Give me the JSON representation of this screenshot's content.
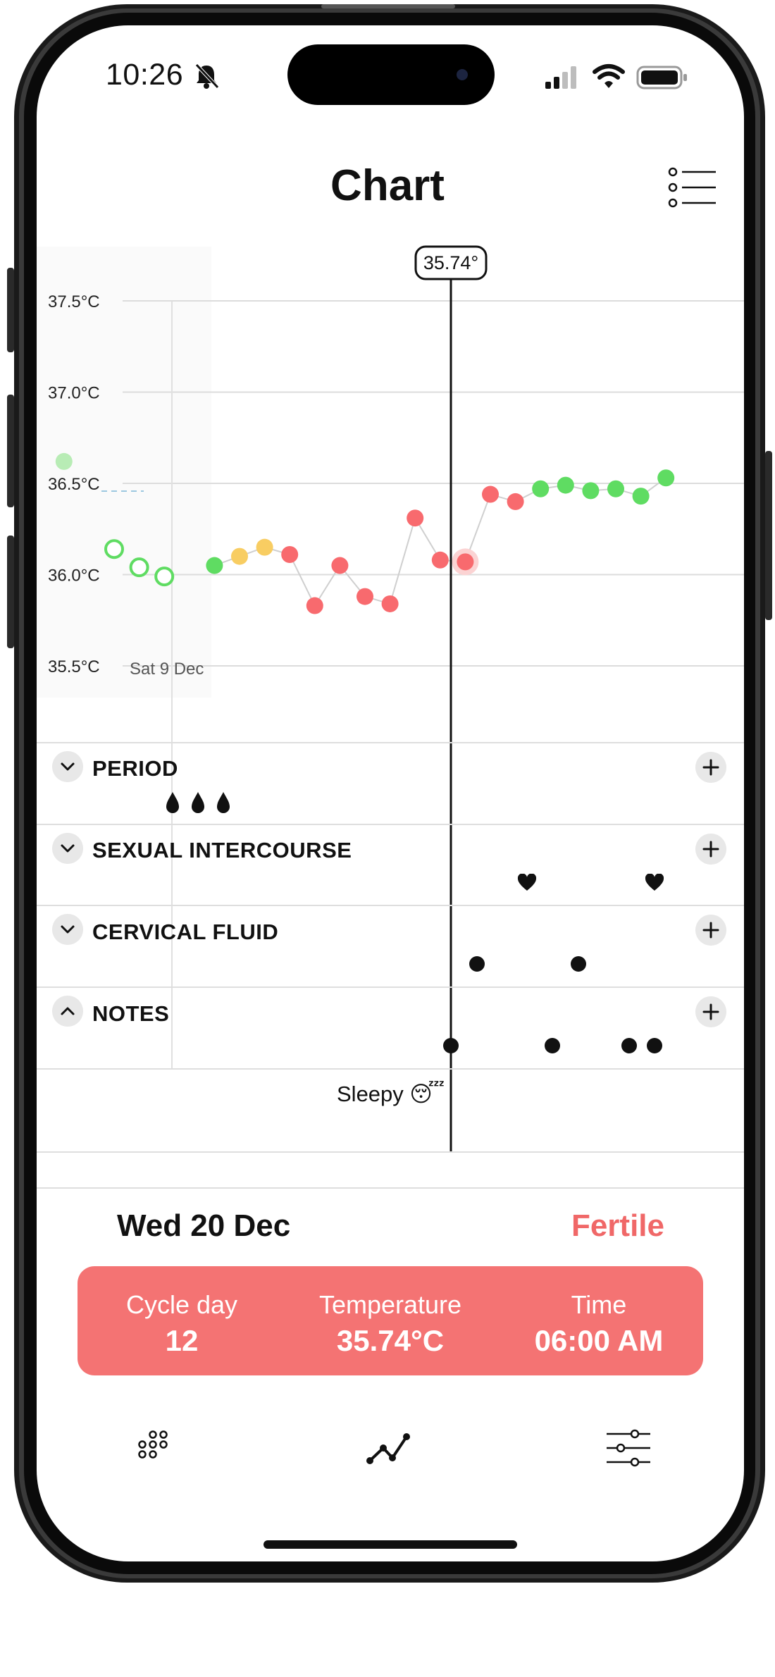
{
  "status_bar": {
    "time": "10:26"
  },
  "header": {
    "title": "Chart"
  },
  "chart": {
    "cursor_label": "35.74°",
    "y_ticks": [
      "37.5°C",
      "37.0°C",
      "36.5°C",
      "36.0°C",
      "35.5°C"
    ],
    "x_tick": "Sat 9 Dec"
  },
  "chart_data": {
    "type": "scatter",
    "title": "",
    "ylabel": "",
    "ylim": [
      35.5,
      37.5
    ],
    "y_ticks": [
      37.5,
      37.0,
      36.5,
      36.0,
      35.5
    ],
    "x_label_first": "Sat 9 Dec",
    "series": [
      {
        "values": [
          {
            "day": 8,
            "temp": 36.62,
            "state": "faded"
          },
          {
            "day": 10,
            "temp": 36.14,
            "state": "hollow"
          },
          {
            "day": 11,
            "temp": 36.04,
            "state": "hollow"
          },
          {
            "day": 12,
            "temp": 35.99,
            "state": "hollow"
          },
          {
            "day": 14,
            "temp": 36.05,
            "state": "green"
          },
          {
            "day": 15,
            "temp": 36.1,
            "state": "yellow"
          },
          {
            "day": 16,
            "temp": 36.15,
            "state": "yellow"
          },
          {
            "day": 17,
            "temp": 36.11,
            "state": "red"
          },
          {
            "day": 18,
            "temp": 35.83,
            "state": "red"
          },
          {
            "day": 19,
            "temp": 36.05,
            "state": "red"
          },
          {
            "day": 20,
            "temp": 35.88,
            "state": "red"
          },
          {
            "day": 21,
            "temp": 35.84,
            "state": "red"
          },
          {
            "day": 22,
            "temp": 36.31,
            "state": "red"
          },
          {
            "day": 23,
            "temp": 36.08,
            "state": "red"
          },
          {
            "day": 24,
            "temp": 36.07,
            "state": "red-selected"
          },
          {
            "day": 25,
            "temp": 36.44,
            "state": "red"
          },
          {
            "day": 26,
            "temp": 36.4,
            "state": "red"
          },
          {
            "day": 27,
            "temp": 36.47,
            "state": "green"
          },
          {
            "day": 28,
            "temp": 36.49,
            "state": "green"
          },
          {
            "day": 29,
            "temp": 36.46,
            "state": "green"
          },
          {
            "day": 30,
            "temp": 36.47,
            "state": "green"
          },
          {
            "day": 31,
            "temp": 36.43,
            "state": "green"
          },
          {
            "day": 32,
            "temp": 36.53,
            "state": "green"
          }
        ]
      }
    ],
    "cursor": {
      "day": 21,
      "temp": 35.74
    },
    "colors": {
      "green": "#5fdc62",
      "yellow": "#f8cd62",
      "red": "#f86a6e",
      "faded": "#b8ecb5"
    },
    "grid": true
  },
  "sections": {
    "period": {
      "label": "PERIOD"
    },
    "sex": {
      "label": "SEXUAL INTERCOURSE"
    },
    "fluid": {
      "label": "CERVICAL FLUID"
    },
    "notes": {
      "label": "NOTES",
      "note": "Sleepy 😴"
    }
  },
  "detail": {
    "date": "Wed 20 Dec",
    "status": "Fertile",
    "cycle_label": "Cycle day",
    "cycle_value": "12",
    "temp_label": "Temperature",
    "temp_value": "35.74°C",
    "time_label": "Time",
    "time_value": "06:00 AM"
  },
  "tabs": [
    "calendar-icon",
    "chart-icon",
    "settings-sliders-icon"
  ],
  "colors": {
    "fertile": "#f06868",
    "card": "#f47373",
    "divider": "#dedede"
  }
}
